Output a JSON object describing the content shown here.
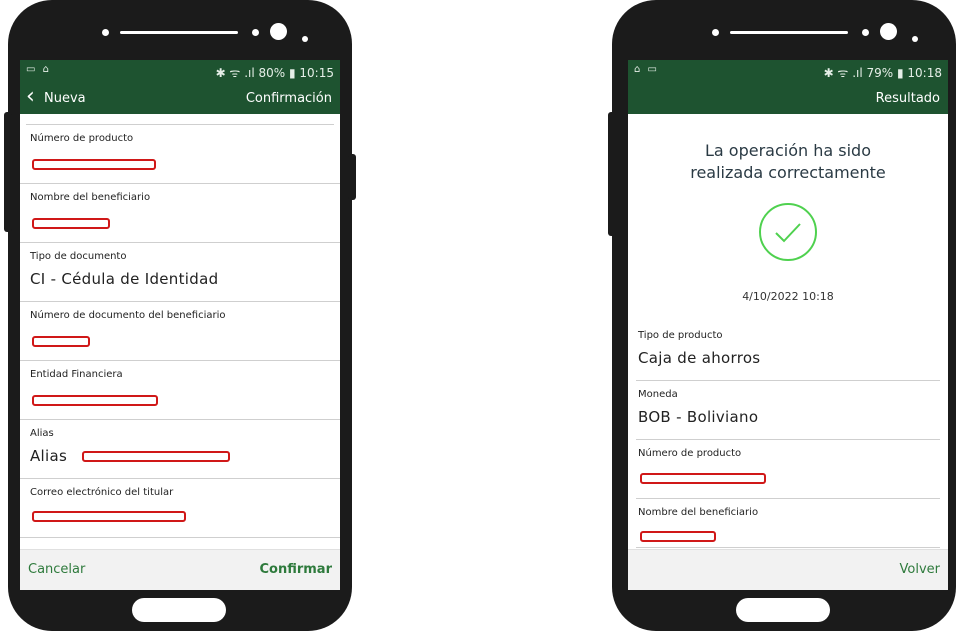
{
  "colors": {
    "brand_green": "#1e5330",
    "action_green": "#2e7a3c",
    "redaction_red": "#d01818"
  },
  "left_phone": {
    "status": {
      "left_icons": "▭ ⌂",
      "right": "✱ ᯤ .ıl 80% ▮ 10:15"
    },
    "appbar": {
      "back_label": "Nueva",
      "title": "Confirmación"
    },
    "fields": [
      {
        "label": "Número de producto",
        "value": ""
      },
      {
        "label": "Nombre del beneficiario",
        "value": ""
      },
      {
        "label": "Tipo de documento",
        "value": "CI - Cédula de Identidad"
      },
      {
        "label": "Número de documento del beneficiario",
        "value": ""
      },
      {
        "label": "Entidad Financiera",
        "value": ""
      },
      {
        "label": "Alias",
        "value": "Alias"
      },
      {
        "label": "Correo electrónico del titular",
        "value": ""
      }
    ],
    "actions": {
      "cancel": "Cancelar",
      "confirm": "Confirmar"
    }
  },
  "right_phone": {
    "status": {
      "left_icons": "⌂ ▭",
      "right": "✱ ᯤ .ıl 79% ▮ 10:18"
    },
    "appbar": {
      "title": "Resultado"
    },
    "success_message": "La operación ha sido realizada correctamente",
    "success_icon": "check-circle-icon",
    "date": "4/10/2022 10:18",
    "fields": [
      {
        "label": "Tipo de producto",
        "value": "Caja de ahorros"
      },
      {
        "label": "Moneda",
        "value": "BOB - Boliviano"
      },
      {
        "label": "Número de producto",
        "value": ""
      },
      {
        "label": "Nombre del beneficiario",
        "value": ""
      }
    ],
    "actions": {
      "back": "Volver"
    }
  }
}
